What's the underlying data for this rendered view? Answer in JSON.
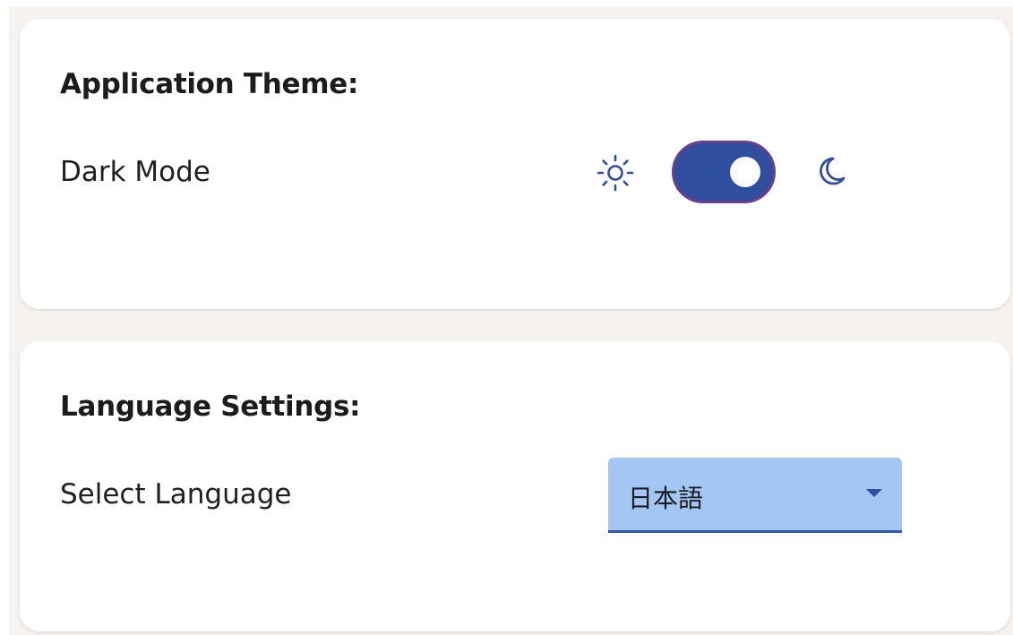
{
  "theme_section": {
    "title": "Application Theme:",
    "dark_mode_label": "Dark Mode",
    "dark_mode_enabled": true,
    "light_icon": "sun-icon",
    "dark_icon": "moon-icon"
  },
  "language_section": {
    "title": "Language Settings:",
    "select_label": "Select Language",
    "selected_language": "日本語"
  },
  "colors": {
    "accent": "#2f4f9e",
    "toggle_outline": "#6a3f8f",
    "select_background": "#a3c6f5",
    "page_background": "#f6f2ef"
  }
}
